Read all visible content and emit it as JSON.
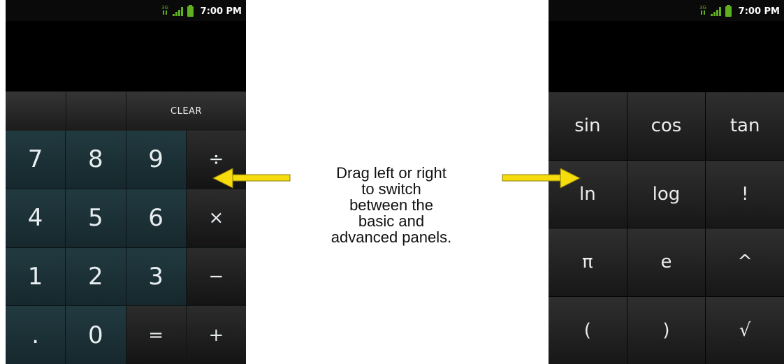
{
  "left_panel": {
    "status": {
      "time": "7:00 PM"
    },
    "clear_label": "CLEAR",
    "keys": [
      "7",
      "8",
      "9",
      "÷",
      "4",
      "5",
      "6",
      "×",
      "1",
      "2",
      "3",
      "−",
      ".",
      "0",
      "=",
      "+"
    ]
  },
  "right_panel": {
    "status": {
      "time": "7:00 PM"
    },
    "keys": [
      "sin",
      "cos",
      "tan",
      "ln",
      "log",
      "!",
      "π",
      "e",
      "^",
      "(",
      ")",
      "√"
    ]
  },
  "annotation": {
    "lines": [
      "Drag left or right",
      "to switch",
      "between the",
      "basic and",
      "advanced panels."
    ]
  },
  "colors": {
    "arrow": "#f5dc0a",
    "status_icon": "#5fb01e"
  },
  "icons": [
    "data-signal-icon",
    "cell-signal-icon",
    "battery-icon",
    "left-arrow-icon",
    "right-arrow-icon"
  ]
}
